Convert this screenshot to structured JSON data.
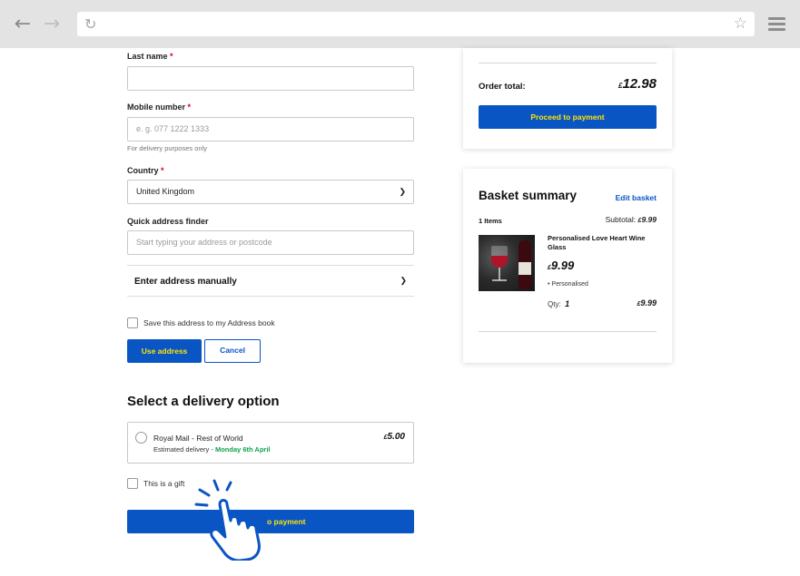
{
  "browser": {
    "back_icon": "arrow-left-icon",
    "forward_icon": "arrow-right-icon",
    "reload_icon": "reload-icon",
    "bookmark_icon": "star-icon",
    "menu_icon": "hamburger-menu-icon"
  },
  "form": {
    "last_name_label": "Last name",
    "last_name_value": "",
    "mobile_label": "Mobile number",
    "mobile_placeholder": "e. g. 077 1222 1333",
    "mobile_hint": "For delivery purposes only",
    "country_label": "Country",
    "country_value": "United Kingdom",
    "finder_label": "Quick address finder",
    "finder_placeholder": "Start typing your address or postcode",
    "manual_label": "Enter address manually",
    "required_mark": "*",
    "save_address_label": "Save this address to my Address book",
    "use_address_button": "Use address",
    "cancel_button": "Cancel"
  },
  "delivery": {
    "title": "Select a delivery option",
    "option_name": "Royal Mail - Rest of World",
    "estimate_prefix": "Estimated delivery - ",
    "estimate_date": "Monday 6th April",
    "currency": "£",
    "price": "5.00",
    "gift_label": "This is a gift",
    "proceed_button": "o payment"
  },
  "order": {
    "total_label": "Order total:",
    "currency": "£",
    "total_value": "12.98",
    "proceed_button": "Proceed to payment"
  },
  "basket": {
    "title": "Basket summary",
    "edit_link": "Edit basket",
    "items_count": "1 Items",
    "subtotal_label": "Subtotal:",
    "currency": "£",
    "subtotal_value": "9.99",
    "product_name": "Personalised Love Heart Wine Glass",
    "product_price": "9.99",
    "product_option": "• Personalised",
    "qty_label": "Qty:",
    "qty_value": "1",
    "line_total": "9.99"
  },
  "colors": {
    "brand_blue": "#0a55c4",
    "button_text_yellow": "#ffe500",
    "date_green": "#12a04b",
    "required_red": "#d0021b"
  }
}
